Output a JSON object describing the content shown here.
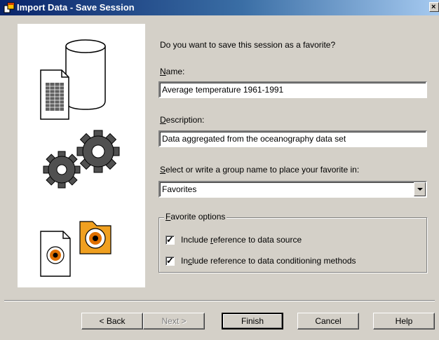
{
  "window": {
    "title": "Import Data - Save Session",
    "close_glyph": "×"
  },
  "prompt": "Do you want to save this session as a favorite?",
  "name_field": {
    "label_prefix": "",
    "label_accel": "N",
    "label_rest": "ame:",
    "value": "Average temperature 1961-1991"
  },
  "description_field": {
    "label_accel": "D",
    "label_rest": "escription:",
    "value": "Data aggregated from the oceanography data set"
  },
  "group_field": {
    "label_accel": "S",
    "label_rest": "elect or write a group name to place your favorite in:",
    "value": "Favorites"
  },
  "favorite_options": {
    "legend_accel": "F",
    "legend_rest": "avorite options",
    "options": [
      {
        "pre": "Include ",
        "accel": "r",
        "post": "eference to data source",
        "checked": true
      },
      {
        "pre": "In",
        "accel": "c",
        "post": "lude reference to data conditioning methods",
        "checked": true
      }
    ]
  },
  "buttons": {
    "back": "< Back",
    "back_accel": "B",
    "next": "Next >",
    "finish": "Finish",
    "cancel": "Cancel",
    "help": "Help"
  },
  "icons": [
    "document-database-icon",
    "gears-icon",
    "target-folder-icon",
    "window-app-icon"
  ],
  "colors": {
    "title_start": "#0a246a",
    "title_end": "#a6caf0",
    "face": "#d4d0c8",
    "folder": "#f0a020",
    "target": "#e07000"
  }
}
